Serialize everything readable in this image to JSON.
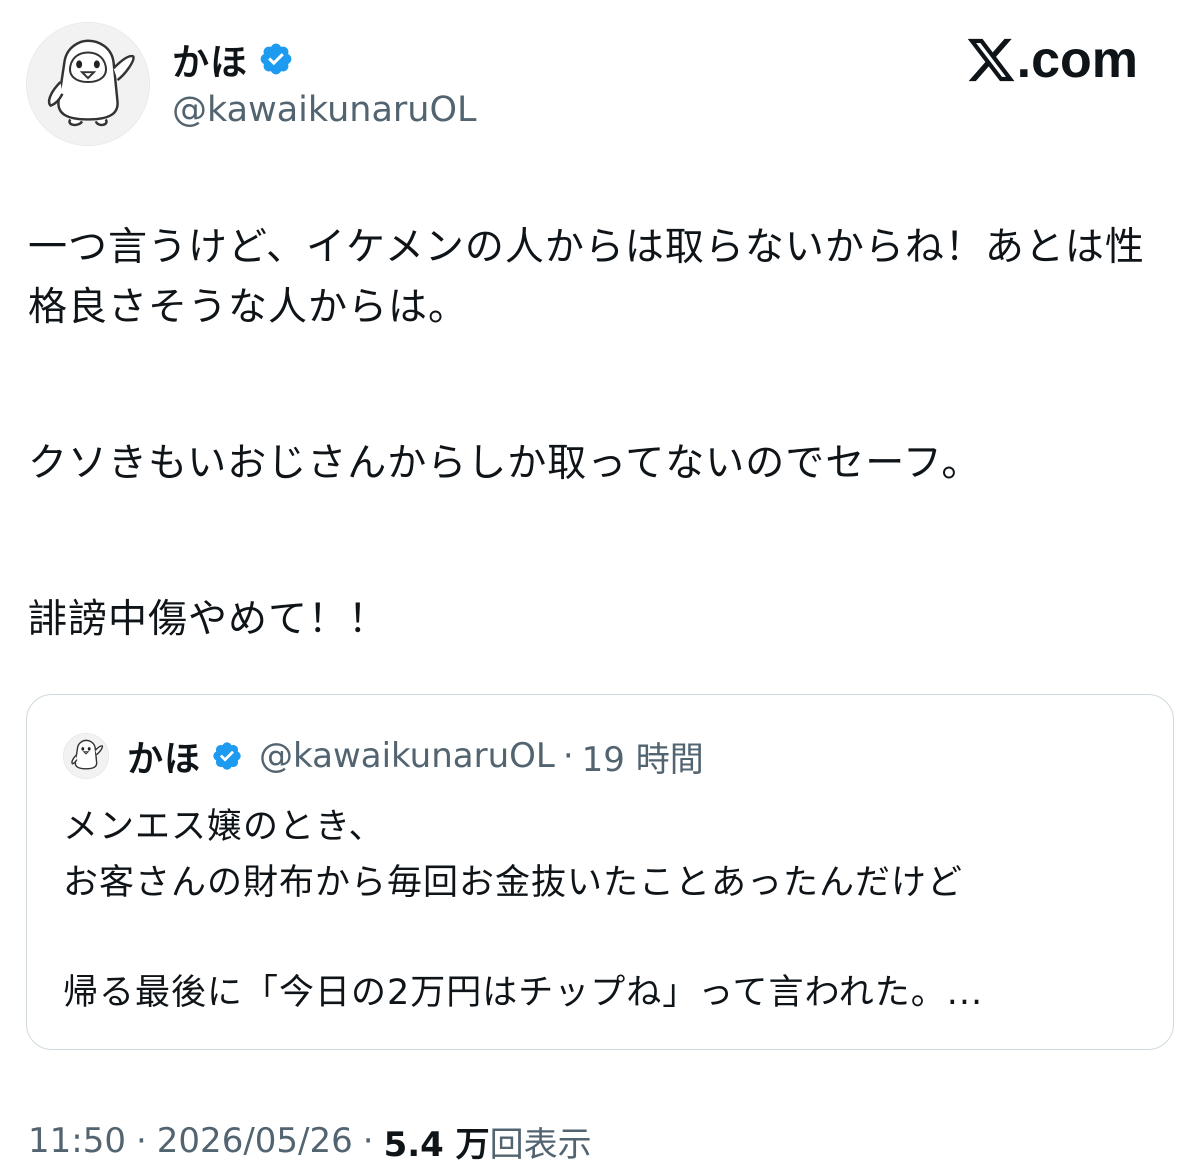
{
  "author": {
    "name": "かほ",
    "handle": "@kawaikunaruOL",
    "avatar_icon": "penguin-avatar-icon",
    "verified_icon": "verified-badge-icon"
  },
  "brand": {
    "text": ".com",
    "icon": "x-logo-icon"
  },
  "tweet": {
    "paragraphs": [
      "一つ言うけど、イケメンの人からは取らないからね！あとは性格良さそうな人からは。",
      "クソきもいおじさんからしか取ってないのでセーフ。",
      "誹謗中傷やめて！！"
    ]
  },
  "quote": {
    "name": "かほ",
    "handle": "@kawaikunaruOL",
    "separator": "·",
    "time": "19 時間",
    "lines": [
      "メンエス嬢のとき、",
      "お客さんの財布から毎回お金抜いたことあったんだけど",
      "帰る最後に「今日の2万円はチップね」って言われた。..."
    ]
  },
  "meta": {
    "time": "11:50",
    "separator": "·",
    "date": "2026/05/26",
    "views_count": "5.4 万",
    "views_label": "回表示"
  },
  "colors": {
    "text": "#0f1419",
    "secondary": "#536471",
    "verified": "#1d9bf0",
    "border": "#cfd9de"
  }
}
